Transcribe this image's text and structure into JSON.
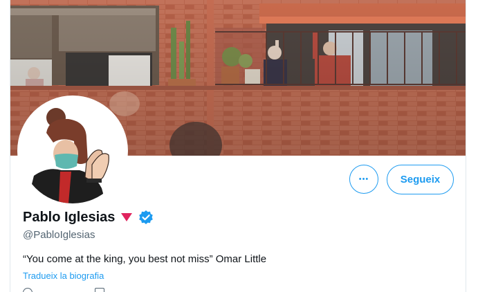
{
  "profile": {
    "display_name": "Pablo Iglesias",
    "handle": "@PabloIglesias",
    "bio": "“You come at the king, you best not miss” Omar Little",
    "translate_link": "Tradueix la biografia",
    "verified": true
  },
  "actions": {
    "more_label": "•••",
    "follow_label": "Segueix"
  },
  "icons": {
    "more": "more-dots-icon",
    "verified": "verified-badge-icon",
    "triangle": "red-triangle-icon",
    "location": "location-icon",
    "calendar": "calendar-icon"
  },
  "colors": {
    "accent": "#1d9bf0",
    "triangle": "#e0245e",
    "text": "#0f1419",
    "muted": "#536471"
  }
}
